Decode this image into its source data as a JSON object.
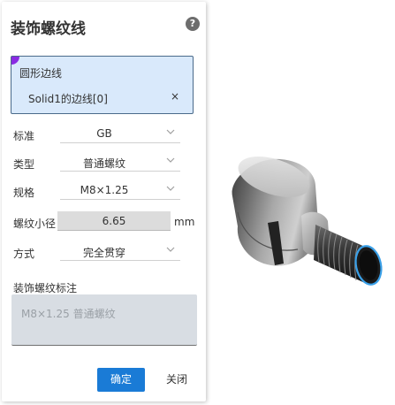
{
  "panel": {
    "title": "装饰螺纹线",
    "help_label": "?",
    "selection": {
      "label": "圆形边线",
      "value": "Solid1的边线[0]",
      "clear_label": "×"
    },
    "fields": [
      {
        "label": "标准",
        "value": "GB"
      },
      {
        "label": "类型",
        "value": "普通螺纹"
      },
      {
        "label": "规格",
        "value": "M8×1.25"
      }
    ],
    "minor_diameter": {
      "label": "螺纹小径",
      "value": "6.65",
      "unit": "mm"
    },
    "method": {
      "label": "方式",
      "value": "完全贯穿"
    },
    "annotation": {
      "label": "装饰螺纹标注",
      "placeholder": "M8×1.25 普通螺纹"
    },
    "ok_label": "确定",
    "close_label": "关闭"
  },
  "colors": {
    "accent": "#1a7bd6",
    "selection_bg": "#d9e9fb",
    "selection_marker": "#8a2be2",
    "highlight_edge": "#3aa0e8"
  },
  "icons": {
    "help": "help-icon",
    "dropdown": "chevron-down-icon",
    "clear": "close-icon"
  }
}
